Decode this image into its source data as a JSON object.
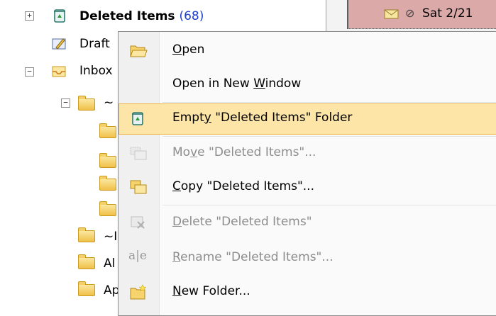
{
  "tree": {
    "deleted_items": {
      "label": "Deleted Items",
      "count": "(68)"
    },
    "drafts": {
      "label": "Draft"
    },
    "inbox": {
      "label": "Inbox"
    },
    "sub1": {
      "label": "~"
    },
    "sub2": {
      "label": "~I"
    },
    "sub3": {
      "label": "Al"
    },
    "sub4": {
      "label": "Ap"
    }
  },
  "message_list": {
    "date": "Sat 2/21"
  },
  "context_menu": {
    "items": [
      {
        "label": "Open",
        "accesskey": "O",
        "icon": "open-folder-icon",
        "enabled": true
      },
      {
        "label": "Open in New Window",
        "accesskey": "W",
        "icon": "",
        "enabled": true
      },
      {
        "label": "Empty \"Deleted Items\" Folder",
        "accesskey": "y",
        "icon": "recycle-bin-icon",
        "enabled": true,
        "highlighted": true
      },
      {
        "label": "Move \"Deleted Items\"...",
        "accesskey": "v",
        "icon": "move-folder-icon",
        "enabled": false
      },
      {
        "label": "Copy \"Deleted Items\"...",
        "accesskey": "C",
        "icon": "copy-folder-icon",
        "enabled": true
      },
      {
        "label": "Delete \"Deleted Items\"",
        "accesskey": "D",
        "icon": "delete-folder-icon",
        "enabled": false
      },
      {
        "label": "Rename \"Deleted Items\"...",
        "accesskey": "R",
        "icon": "rename-icon",
        "enabled": false
      },
      {
        "label": "New Folder...",
        "accesskey": "N",
        "icon": "new-folder-icon",
        "enabled": true
      }
    ]
  },
  "colors": {
    "highlight": "#fde5a7",
    "highlight_border": "#f0b547",
    "count_blue": "#1f3fd0",
    "message_row": "#dca9a9"
  }
}
